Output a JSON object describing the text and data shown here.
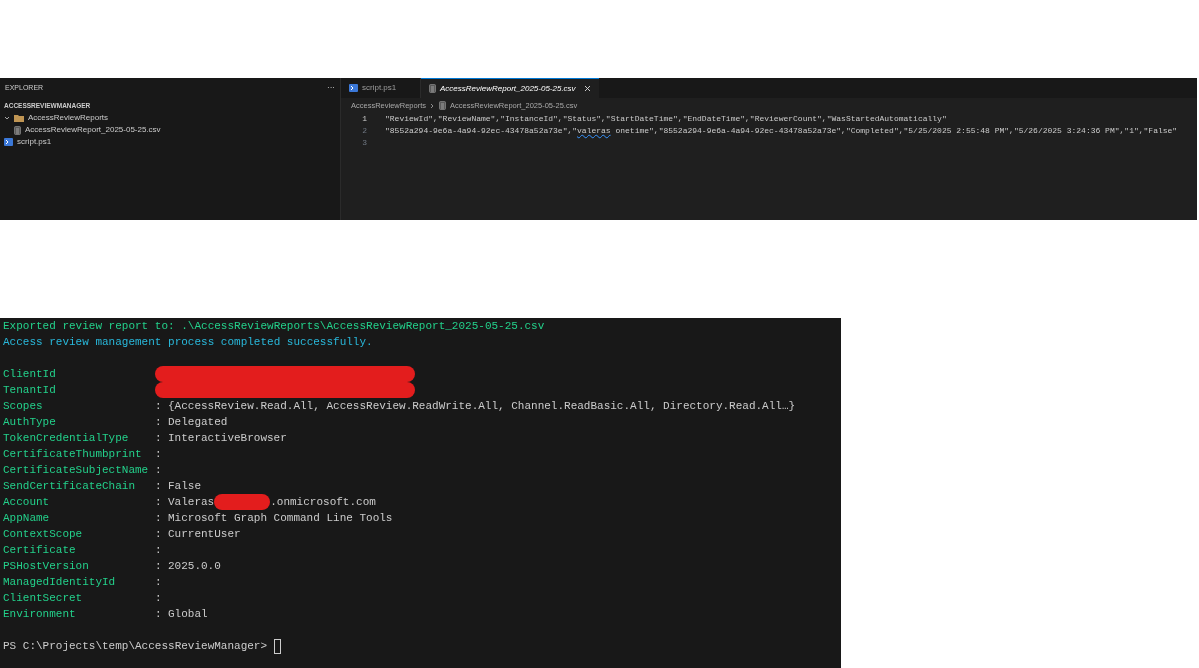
{
  "editor": {
    "explorer": {
      "title": "EXPLORER",
      "more": "···",
      "root": "ACCESSREVIEWMANAGER",
      "tree": [
        {
          "label": "AccessReviewReports",
          "kind": "folder",
          "expanded": true,
          "children": [
            {
              "label": "AccessReviewReport_2025-05-25.csv",
              "kind": "csv"
            }
          ]
        },
        {
          "label": "script.ps1",
          "kind": "ps1"
        }
      ]
    },
    "tabs": [
      {
        "label": "script.ps1",
        "kind": "ps1",
        "selected": false
      },
      {
        "label": "AccessReviewReport_2025-05-25.csv",
        "kind": "csv",
        "selected": true
      }
    ],
    "breadcrumb": [
      "AccessReviewReports",
      "AccessReviewReport_2025-05-25.csv"
    ],
    "lines": [
      {
        "number": "1",
        "current": true,
        "parts": [
          {
            "kind": "text",
            "text": "\"ReviewId\",\"ReviewName\",\"InstanceId\",\"Status\",\"StartDateTime\",\"EndDateTime\",\"ReviewerCount\",\"WasStartedAutomatically\""
          }
        ]
      },
      {
        "number": "2",
        "current": false,
        "parts": [
          {
            "kind": "text",
            "text": "\"8552a294-9e6a-4a94-92ec-43478a52a73e\",\""
          },
          {
            "kind": "misspelled",
            "text": "valeras"
          },
          {
            "kind": "text",
            "text": " onetime\",\"8552a294-9e6a-4a94-92ec-43478a52a73e\",\"Completed\",\"5/25/2025 2:55:48 PM\",\"5/26/2025 3:24:36 PM\",\"1\",\"False\""
          }
        ]
      },
      {
        "number": "3",
        "current": false
      }
    ]
  },
  "terminal": {
    "messages": [
      {
        "text": "Exported review report to: .\\AccessReviewReports\\AccessReviewReport_2025-05-25.csv",
        "kind": "success"
      },
      {
        "text": "Access review management process completed successfully.",
        "kind": "info"
      }
    ],
    "properties": [
      {
        "key": "ClientId",
        "parts": [
          {
            "kind": "redaction"
          }
        ]
      },
      {
        "key": "TenantId",
        "parts": [
          {
            "kind": "redaction"
          }
        ]
      },
      {
        "key": "Scopes",
        "separator": ":",
        "parts": [
          {
            "kind": "text",
            "text": "{AccessReview.Read.All, AccessReview.ReadWrite.All, Channel.ReadBasic.All, Directory.Read.All…}"
          }
        ]
      },
      {
        "key": "AuthType",
        "separator": ":",
        "parts": [
          {
            "kind": "text",
            "text": "Delegated"
          }
        ]
      },
      {
        "key": "TokenCredentialType",
        "separator": ":",
        "parts": [
          {
            "kind": "text",
            "text": "InteractiveBrowser"
          }
        ]
      },
      {
        "key": "CertificateThumbprint",
        "separator": ":"
      },
      {
        "key": "CertificateSubjectName",
        "separator": ":"
      },
      {
        "key": "SendCertificateChain",
        "separator": ":",
        "parts": [
          {
            "kind": "text",
            "text": "False"
          }
        ]
      },
      {
        "key": "Account",
        "separator": ":",
        "parts": [
          {
            "kind": "text",
            "text": "Valeras"
          },
          {
            "kind": "redaction"
          },
          {
            "kind": "text",
            "text": ".onmicrosoft.com"
          }
        ]
      },
      {
        "key": "AppName",
        "separator": ":",
        "parts": [
          {
            "kind": "text",
            "text": "Microsoft Graph Command Line Tools"
          }
        ]
      },
      {
        "key": "ContextScope",
        "separator": ":",
        "parts": [
          {
            "kind": "text",
            "text": "CurrentUser"
          }
        ]
      },
      {
        "key": "Certificate",
        "separator": ":"
      },
      {
        "key": "PSHostVersion",
        "separator": ":",
        "parts": [
          {
            "kind": "text",
            "text": "2025.0.0"
          }
        ]
      },
      {
        "key": "ManagedIdentityId",
        "separator": ":"
      },
      {
        "key": "ClientSecret",
        "separator": ":"
      },
      {
        "key": "Environment",
        "separator": ":",
        "parts": [
          {
            "kind": "text",
            "text": "Global"
          }
        ]
      }
    ],
    "prompt": "PS C:\\Projects\\temp\\AccessReviewManager>"
  }
}
